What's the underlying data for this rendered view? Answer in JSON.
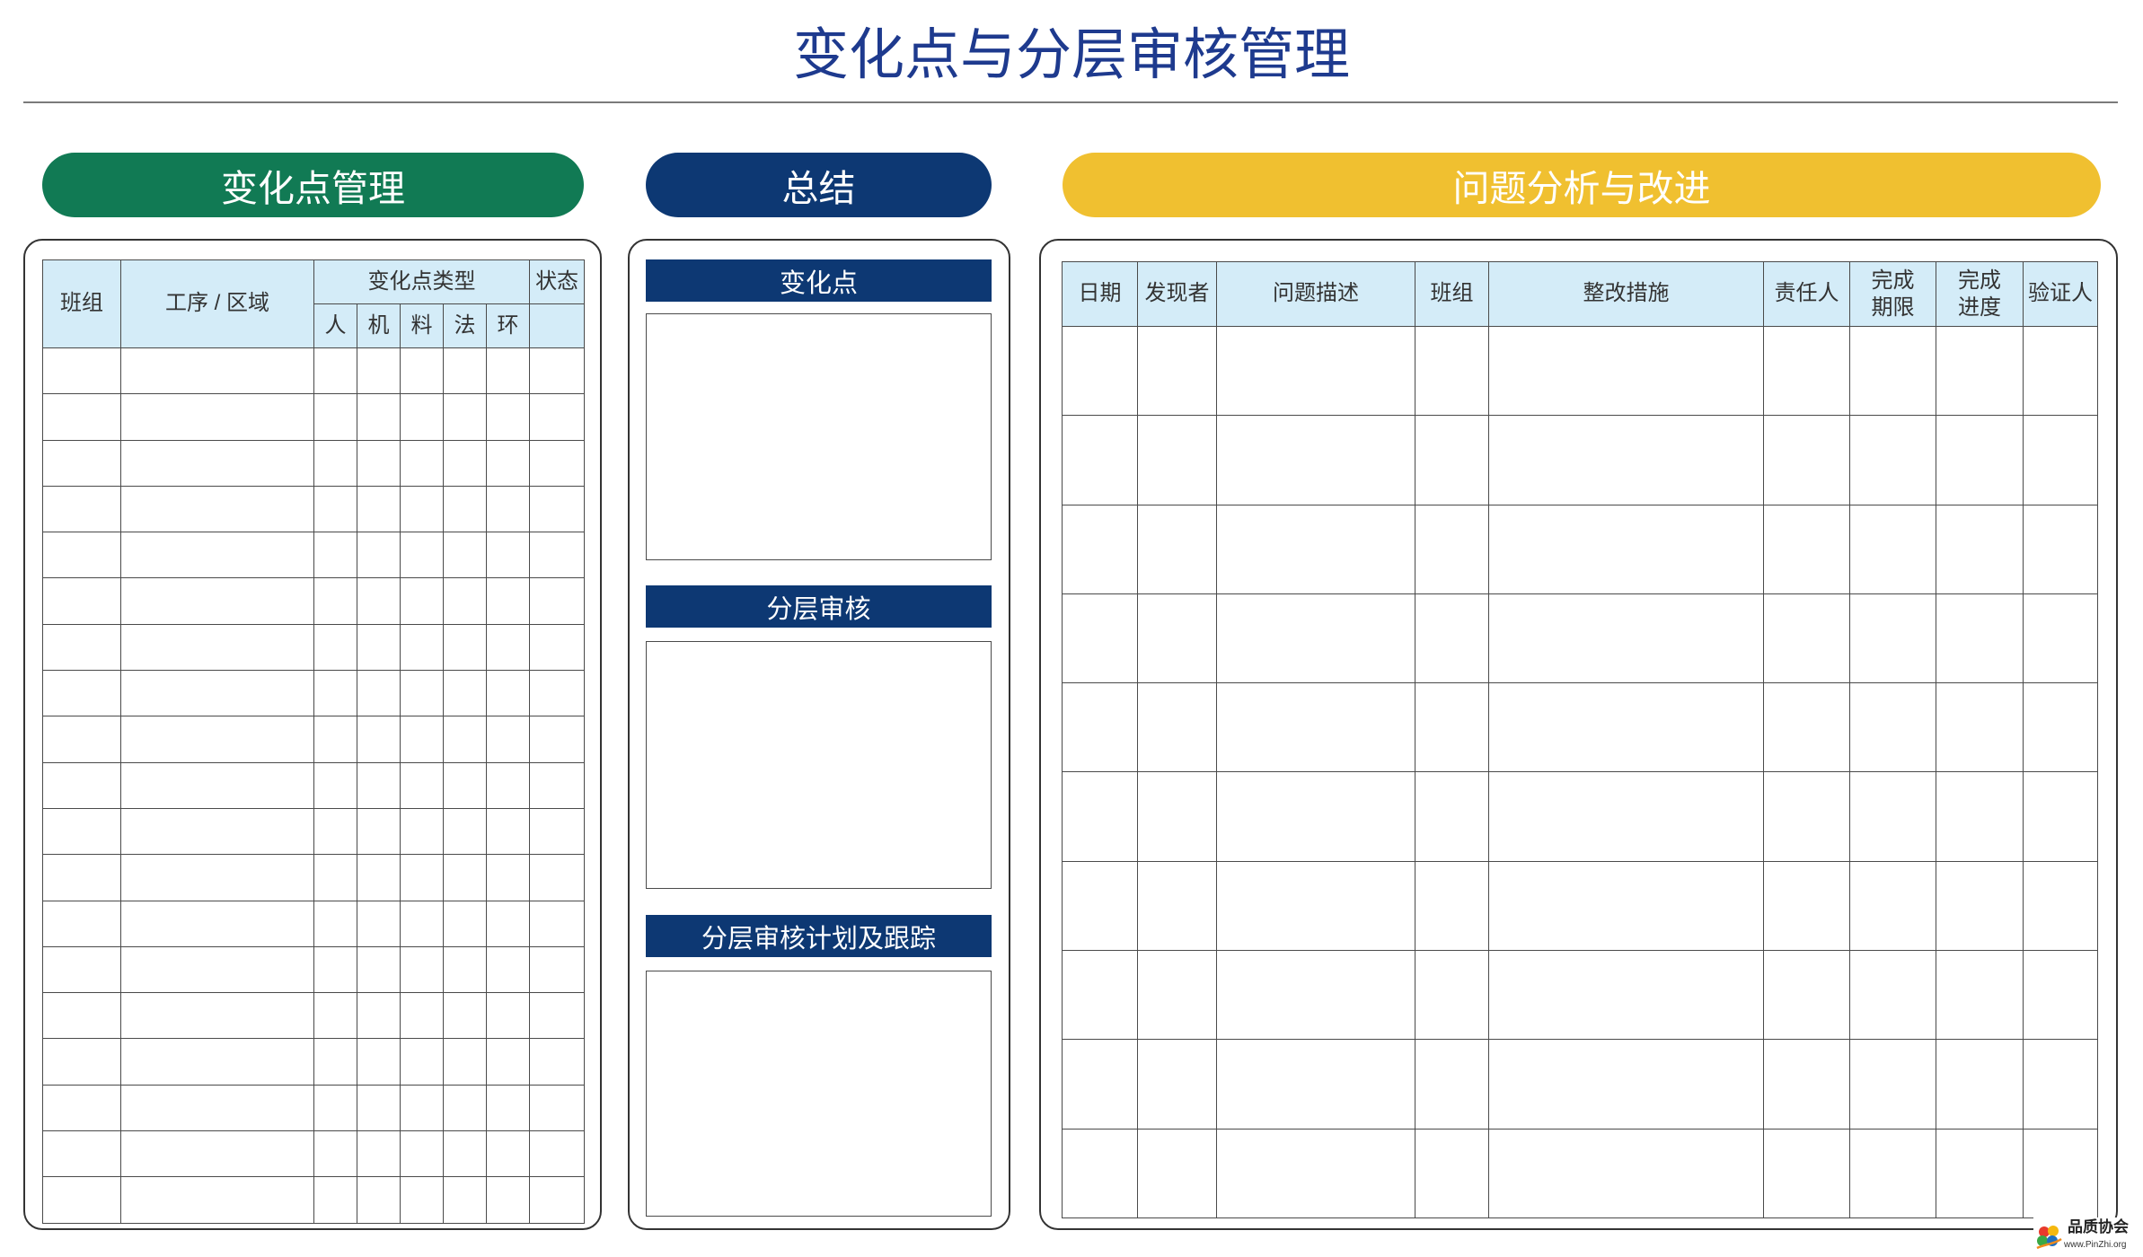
{
  "title": "变化点与分层审核管理",
  "colors": {
    "title_text": "#1e3a8e",
    "change_management_pill": "#117a54",
    "summary_pill": "#0d3873",
    "problem_analysis_pill": "#f0c030",
    "summary_bar": "#0d3873",
    "table_header_fill": "#d4ecf8"
  },
  "change_management": {
    "label": "变化点管理",
    "table": {
      "team": "班组",
      "process_area": "工序 / 区域",
      "change_type": "变化点类型",
      "change_type_items": [
        "人",
        "机",
        "料",
        "法",
        "环"
      ],
      "status": "状态"
    }
  },
  "summary": {
    "label": "总结",
    "sections": [
      "变化点",
      "分层审核",
      "分层审核计划及跟踪"
    ]
  },
  "problem_analysis": {
    "label": "问题分析与改进",
    "table": {
      "headers": [
        "日期",
        "发现者",
        "问题描述",
        "班组",
        "整改措施",
        "责任人",
        "完成期限",
        "完成进度",
        "验证人"
      ]
    }
  },
  "logo": {
    "name": "品质协会",
    "website": "www.PinZhi.org",
    "icon": "pinzhi-logo-icon"
  }
}
